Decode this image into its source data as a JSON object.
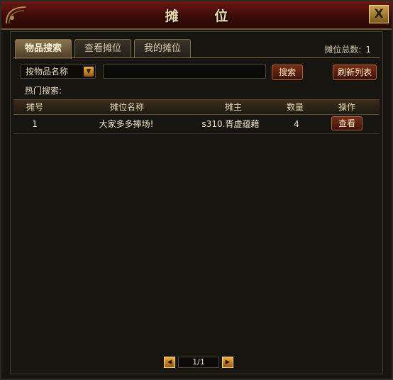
{
  "window": {
    "title": "摊 位",
    "close_label": "X"
  },
  "tabs": [
    {
      "label": "物品搜索",
      "active": true
    },
    {
      "label": "查看摊位",
      "active": false
    },
    {
      "label": "我的摊位",
      "active": false
    }
  ],
  "total": {
    "label": "摊位总数:",
    "value": "1"
  },
  "search": {
    "select_value": "按物品名称",
    "input_value": "",
    "search_label": "搜索",
    "refresh_label": "刷新列表",
    "hot_label": "热门搜索:"
  },
  "table": {
    "headers": [
      "摊号",
      "摊位名称",
      "摊主",
      "数量",
      "操作"
    ],
    "rows": [
      {
        "id": "1",
        "name": "大家多多捧场!",
        "owner": "s310.胥虚蕴藉",
        "qty": "4",
        "action": "查看"
      }
    ]
  },
  "pager": {
    "page": "1/1"
  },
  "colors": {
    "accent": "#e7b340",
    "title_bar": "#6a1a12",
    "button": "#7a2c15"
  }
}
